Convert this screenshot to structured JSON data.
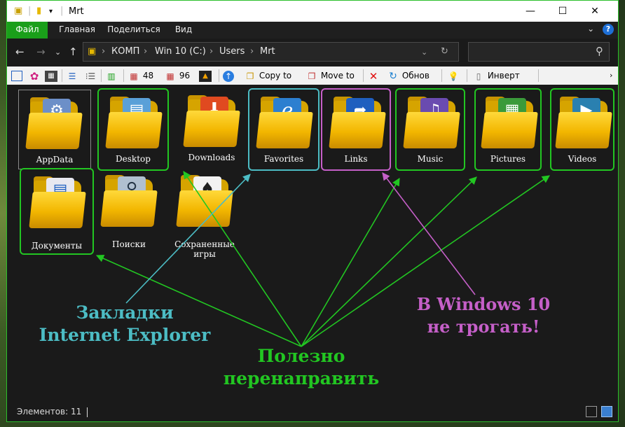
{
  "window": {
    "title": "Mrt",
    "controls": {
      "minimize": "—",
      "maximize": "☐",
      "close": "✕"
    }
  },
  "ribbon": {
    "tabs": [
      "Файл",
      "Главная",
      "Поделиться",
      "Вид"
    ],
    "help": "?"
  },
  "address": {
    "segments": [
      "КОМП",
      "Win 10 (C:)",
      "Users",
      "Mrt"
    ],
    "separator": "›",
    "search_value": ""
  },
  "toolbar": {
    "count1": "48",
    "count2": "96",
    "copy_to": "Copy to",
    "move_to": "Move to",
    "refresh": "Обнов",
    "invert": "Инверт"
  },
  "items": [
    {
      "label": "AppData",
      "emblem": "gear-icon",
      "color": "#6c8fc8",
      "glyph": "⚙"
    },
    {
      "label": "Desktop",
      "emblem": "desktop-icon",
      "color": "#5aa0d8",
      "glyph": "▤"
    },
    {
      "label": "Downloads",
      "emblem": "download-icon",
      "color": "#e04a20",
      "glyph": "⬇"
    },
    {
      "label": "Favorites",
      "emblem": "internet-explorer-icon",
      "color": "#2c7fd0",
      "glyph": "e"
    },
    {
      "label": "Links",
      "emblem": "shortcut-arrow-icon",
      "color": "#1f5fbf",
      "glyph": "➦"
    },
    {
      "label": "Music",
      "emblem": "speaker-icon",
      "color": "#6a4bb0",
      "glyph": "♫"
    },
    {
      "label": "Pictures",
      "emblem": "photos-icon",
      "color": "#3a9a3a",
      "glyph": "▦"
    },
    {
      "label": "Videos",
      "emblem": "film-icon",
      "color": "#2a80b0",
      "glyph": "▶"
    },
    {
      "label": "Документы",
      "emblem": "documents-icon",
      "color": "#e8e8f0",
      "glyph": "▤"
    },
    {
      "label": "Поиски",
      "emblem": "magnifier-icon",
      "color": "#b0c0d0",
      "glyph": "⚲"
    },
    {
      "label": "Сохраненные игры",
      "emblem": "spade-icon",
      "color": "#202020",
      "glyph": "♠"
    }
  ],
  "annotations": {
    "bookmarks_line1": "Закладки",
    "bookmarks_line2": "Internet Explorer",
    "redirect_line1": "Полезно",
    "redirect_line2": "перенаправить",
    "dont_touch_line1": "В Windows 10",
    "dont_touch_line2": "не трогать!"
  },
  "status": {
    "items_count": "Элементов: 11"
  },
  "colors": {
    "accent_green": "#22c622",
    "cyan": "#4cbcc4",
    "purple": "#c55fc8"
  }
}
